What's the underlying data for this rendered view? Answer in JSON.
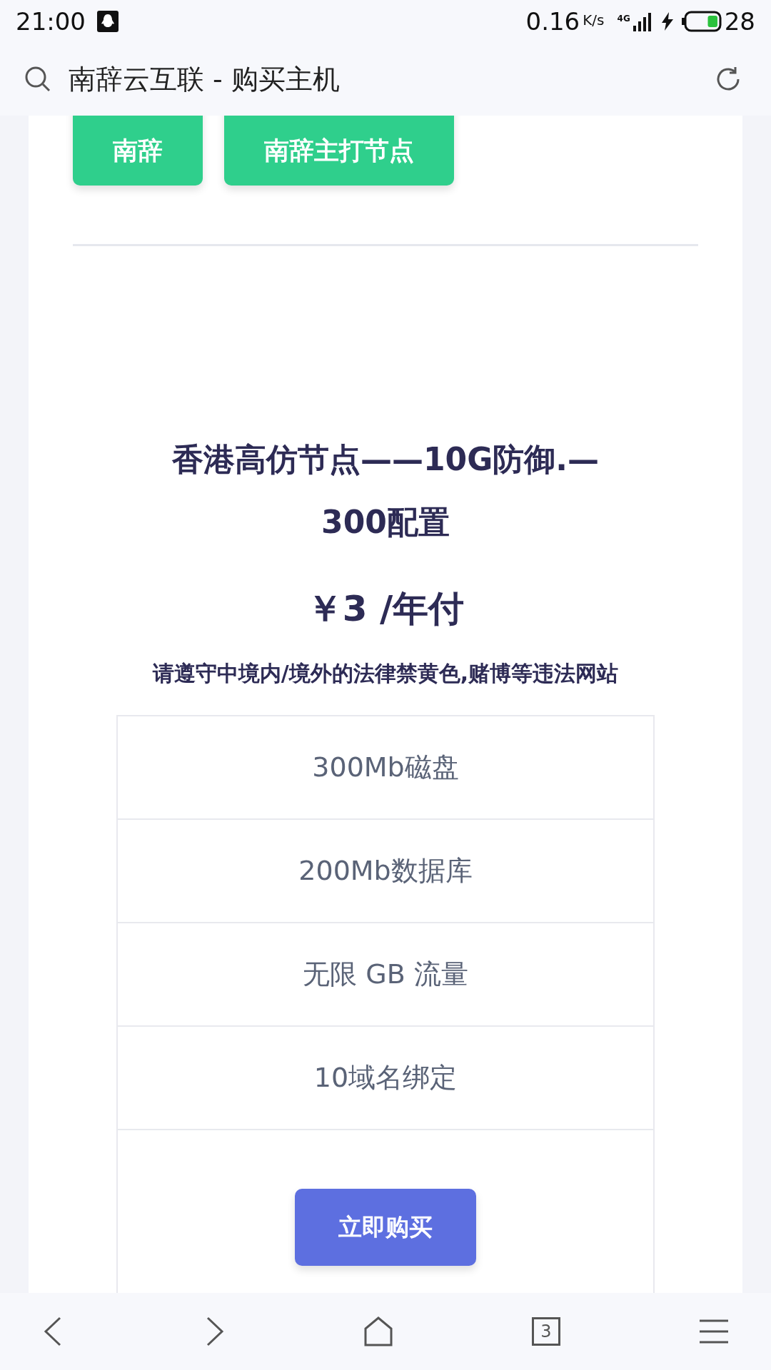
{
  "status_bar": {
    "time": "21:00",
    "speed": "0.16",
    "speed_unit": "K/s",
    "network": "4G",
    "battery": {
      "percent": "28",
      "level": 0.3
    },
    "charging": true
  },
  "address_bar": {
    "title": "南辞云互联 - 购买主机"
  },
  "groups": [
    {
      "label": "南辞",
      "selected": false
    },
    {
      "label": "南辞主打节点",
      "selected": false
    }
  ],
  "plan": {
    "title": "香港高仿节点——10G防御.—300配置",
    "price": "￥3 /年付",
    "notice": "请遵守中境内/境外的法律禁黄色,赌博等违法网站",
    "features": [
      "300Mb磁盘",
      "200Mb数据库",
      "无限 GB 流量",
      "10域名绑定"
    ],
    "buy_button": "立即购买"
  },
  "bottom_nav": {
    "tab_count": "3"
  }
}
